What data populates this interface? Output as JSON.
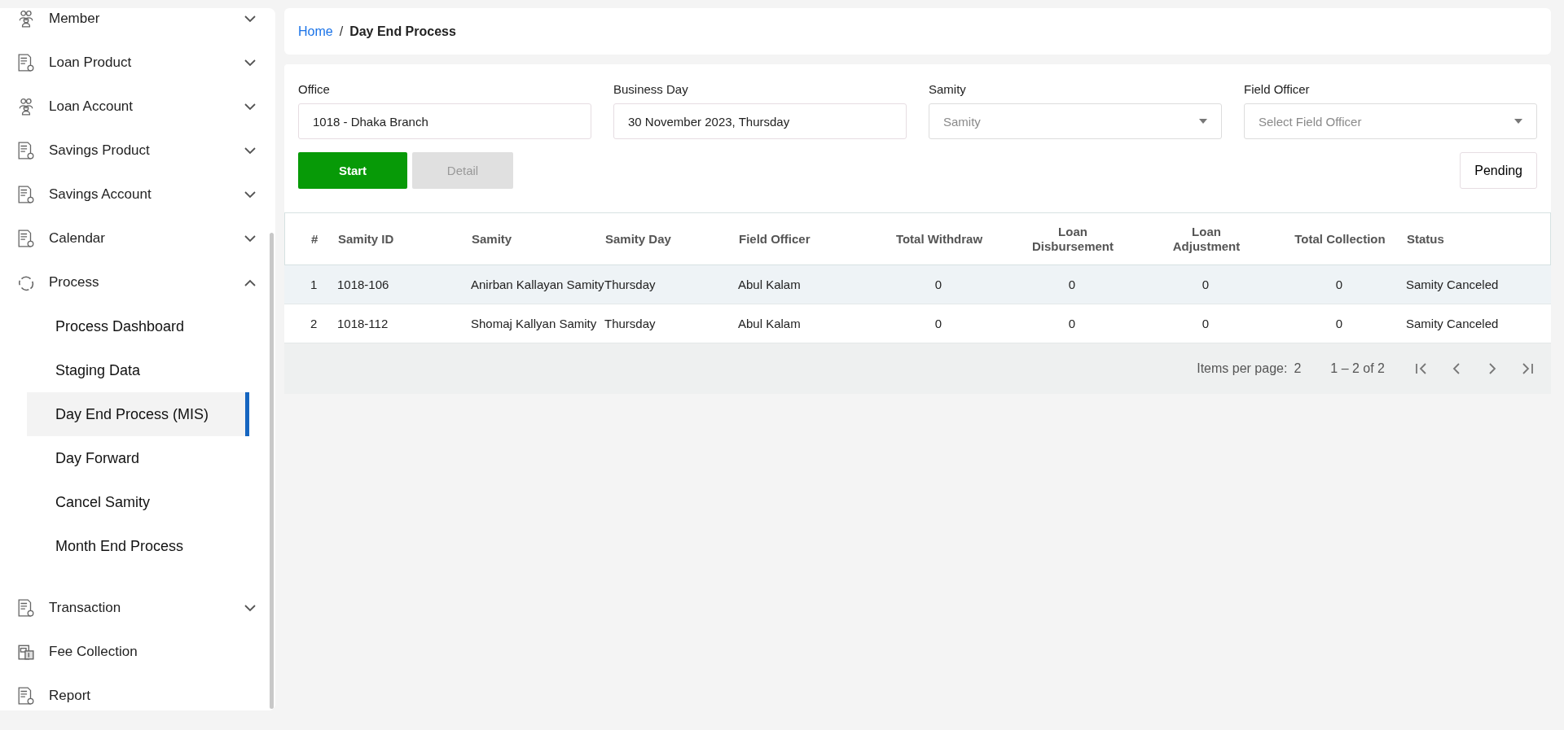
{
  "sidebar": {
    "items": [
      {
        "label": "Member",
        "kind": "people",
        "expanded": false
      },
      {
        "label": "Loan Product",
        "kind": "document",
        "expanded": false
      },
      {
        "label": "Loan Account",
        "kind": "people",
        "expanded": false
      },
      {
        "label": "Savings Product",
        "kind": "document",
        "expanded": false
      },
      {
        "label": "Savings Account",
        "kind": "document",
        "expanded": false
      },
      {
        "label": "Calendar",
        "kind": "document",
        "expanded": false
      },
      {
        "label": "Process",
        "kind": "process",
        "expanded": true,
        "children": [
          {
            "label": "Process Dashboard",
            "selected": false
          },
          {
            "label": "Staging Data",
            "selected": false
          },
          {
            "label": "Day End Process (MIS)",
            "selected": true
          },
          {
            "label": "Day Forward",
            "selected": false
          },
          {
            "label": "Cancel Samity",
            "selected": false
          },
          {
            "label": "Month End Process",
            "selected": false
          }
        ]
      },
      {
        "label": "Transaction",
        "kind": "document",
        "expanded": false
      },
      {
        "label": "Fee Collection",
        "kind": "fee"
      },
      {
        "label": "Report",
        "kind": "document"
      }
    ]
  },
  "breadcrumb": {
    "separator": "/",
    "items": [
      {
        "label": "Home",
        "kind": "link"
      },
      {
        "label": "Day End Process",
        "kind": "current"
      }
    ]
  },
  "filters": [
    {
      "label": "Office",
      "kind": "text",
      "value": "1018 - Dhaka Branch"
    },
    {
      "label": "Business Day",
      "kind": "text",
      "value": "30 November 2023, Thursday"
    },
    {
      "label": "Samity",
      "kind": "select",
      "placeholder": "Samity"
    },
    {
      "label": "Field Officer",
      "kind": "select",
      "placeholder": "Select Field Officer"
    }
  ],
  "actions": [
    {
      "label": "Start",
      "disabled": false
    },
    {
      "label": "Detail",
      "disabled": true
    }
  ],
  "pending_button": "Pending",
  "table": {
    "columns": [
      "#",
      "Samity ID",
      "Samity",
      "Samity Day",
      "Field Officer",
      "Total Withdraw",
      "Loan Disbursement",
      "Loan Adjustment",
      "Total Collection",
      "Status"
    ],
    "rows": [
      {
        "hovered": true,
        "cells": [
          "1",
          "1018-106",
          "Anirban Kallayan Samity",
          "Thursday",
          "Abul Kalam",
          "0",
          "0",
          "0",
          "0",
          "Samity Canceled"
        ]
      },
      {
        "hovered": false,
        "cells": [
          "2",
          "1018-112",
          "Shomaj Kallyan Samity",
          "Thursday",
          "Abul Kalam",
          "0",
          "0",
          "0",
          "0",
          "Samity Canceled"
        ]
      }
    ]
  },
  "paginator": {
    "items_per_page_label": "Items per page:",
    "items_per_page": "2",
    "range": "1 – 2 of 2"
  }
}
